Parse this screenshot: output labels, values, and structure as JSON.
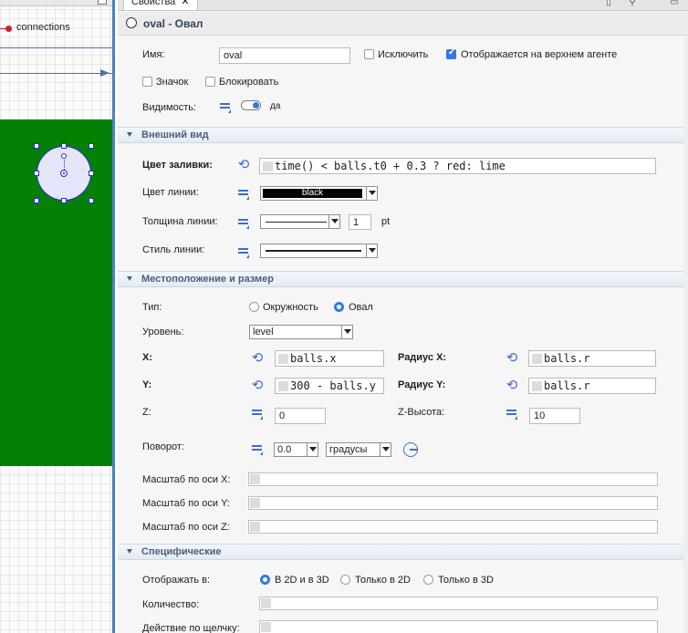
{
  "canvas": {
    "connections_label": "connections"
  },
  "panel": {
    "tab_label": "Свойства",
    "tab_close": "✕",
    "title": "oval - Овал"
  },
  "general": {
    "name_label": "Имя:",
    "name_value": "oval",
    "exclude_label": "Исключить",
    "exclude_checked": false,
    "show_top_label": "Отображается на верхнем агенте",
    "show_top_checked": true,
    "icon_label": "Значок",
    "icon_checked": false,
    "lock_label": "Блокировать",
    "lock_checked": false,
    "visibility_label": "Видимость:",
    "visibility_value": "да"
  },
  "appearance": {
    "section_title": "Внешний вид",
    "fill_label": "Цвет заливки:",
    "fill_value": "time() < balls.t0 + 0.3 ? red: lime",
    "line_color_label": "Цвет линии:",
    "line_color_value": "black",
    "line_width_label": "Толщина линии:",
    "line_width_value": "1",
    "line_width_unit": "pt",
    "line_style_label": "Стиль линии:"
  },
  "position": {
    "section_title": "Местоположение и размер",
    "type_label": "Тип:",
    "type_circle": "Окружность",
    "type_oval": "Овал",
    "type_selected": "oval",
    "level_label": "Уровень:",
    "level_value": "level",
    "x_label": "X:",
    "x_value": "balls.x",
    "radius_x_label": "Радиус X:",
    "radius_x_value": "balls.r",
    "y_label": "Y:",
    "y_value": "300 - balls.y",
    "radius_y_label": "Радиус Y:",
    "radius_y_value": "balls.r",
    "z_label": "Z:",
    "z_value": "0",
    "zheight_label": "Z-Высота:",
    "zheight_value": "10",
    "rotation_label": "Поворот:",
    "rotation_value": "0.0",
    "rotation_unit": "градусы",
    "scale_x_label": "Масштаб по оси X:",
    "scale_y_label": "Масштаб по оси Y:",
    "scale_z_label": "Масштаб по оси Z:"
  },
  "specific": {
    "section_title": "Специфические",
    "show_in_label": "Отображать в:",
    "opt_2d3d": "В 2D и в 3D",
    "opt_2d": "Только в 2D",
    "opt_3d": "Только в 3D",
    "show_in_selected": "2d3d",
    "count_label": "Количество:",
    "onclick_label": "Действие по щелчку:"
  },
  "colors": {
    "accent": "#2f7ae5",
    "canvas_green": "#048004",
    "oval_fill": "#e6e6fa",
    "oval_stroke": "#2b2bd6",
    "section_text": "#4a5e7a"
  }
}
